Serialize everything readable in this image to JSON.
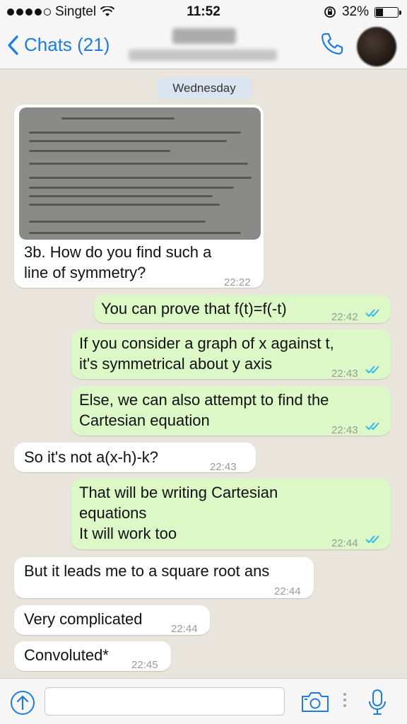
{
  "status_bar": {
    "carrier": "Singtel",
    "time": "11:52",
    "battery": "32%",
    "battery_level": 0.32,
    "signal_bars": 4
  },
  "nav": {
    "back_label": "Chats (21)"
  },
  "chat": {
    "date_label": "Wednesday",
    "messages": [
      {
        "dir": "in",
        "text_lines": [
          "3b. How do you find such a",
          "line of symmetry?"
        ],
        "time": "22:22",
        "has_image": true
      },
      {
        "dir": "out",
        "text_lines": [
          "You can prove that f(t)=f(-t)"
        ],
        "time": "22:42",
        "read": true
      },
      {
        "dir": "out",
        "text_lines": [
          "If you consider a graph of x against t,",
          "it's symmetrical about y axis"
        ],
        "time": "22:43",
        "read": true
      },
      {
        "dir": "out",
        "text_lines": [
          "Else, we can also attempt to find the",
          "Cartesian equation"
        ],
        "time": "22:43",
        "read": true
      },
      {
        "dir": "in",
        "text_lines": [
          "So it's not a(x-h)-k?"
        ],
        "time": "22:43"
      },
      {
        "dir": "out",
        "text_lines": [
          "That will be writing Cartesian",
          "equations",
          "It will work too"
        ],
        "time": "22:44",
        "read": true
      },
      {
        "dir": "in",
        "text_lines": [
          "But it leads me to a square root ans"
        ],
        "time": "22:44"
      },
      {
        "dir": "in",
        "text_lines": [
          "Very complicated"
        ],
        "time": "22:44"
      },
      {
        "dir": "in",
        "text_lines": [
          "Convoluted*"
        ],
        "time": "22:45"
      }
    ]
  },
  "input": {
    "placeholder": ""
  },
  "colors": {
    "accent": "#1f7be0",
    "incoming_bubble": "#ffffff",
    "outgoing_bubble": "#dcf8c6",
    "read_ticks": "#34b7f1",
    "background": "#e9e4dc"
  },
  "icons": {
    "back": "chevron-left-icon",
    "call": "phone-icon",
    "share": "upload-arrow-icon",
    "camera": "camera-icon",
    "mic": "microphone-icon",
    "read": "double-check-icon"
  }
}
